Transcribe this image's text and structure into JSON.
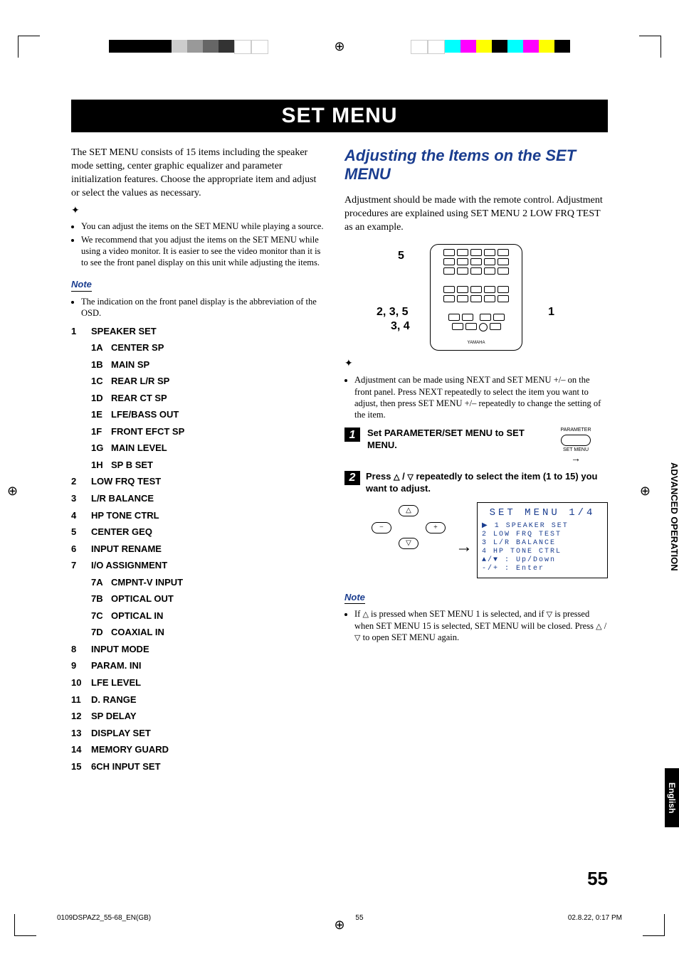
{
  "header": {
    "title": "SET MENU"
  },
  "left_column": {
    "intro": "The SET MENU consists of 15 items including the speaker mode setting, center graphic equalizer and parameter initialization features. Choose the appropriate item and adjust or select the values as necessary.",
    "hint_bullets": [
      "You can adjust the items on the SET MENU while playing a source.",
      "We recommend that you adjust the items on the SET MENU while using a video monitor. It is easier to see the video monitor than it is to see the front panel display on this unit while adjusting the items."
    ],
    "note_label": "Note",
    "note_bullets": [
      "The indication on the front panel display is the abbreviation of the OSD."
    ],
    "menu": [
      {
        "n": "1",
        "label": "SPEAKER SET",
        "subs": [
          {
            "n": "1A",
            "label": "CENTER SP"
          },
          {
            "n": "1B",
            "label": "MAIN SP"
          },
          {
            "n": "1C",
            "label": "REAR L/R SP"
          },
          {
            "n": "1D",
            "label": "REAR CT SP"
          },
          {
            "n": "1E",
            "label": "LFE/BASS OUT"
          },
          {
            "n": "1F",
            "label": "FRONT EFCT SP"
          },
          {
            "n": "1G",
            "label": "MAIN LEVEL"
          },
          {
            "n": "1H",
            "label": "SP B SET"
          }
        ]
      },
      {
        "n": "2",
        "label": "LOW FRQ TEST"
      },
      {
        "n": "3",
        "label": "L/R BALANCE"
      },
      {
        "n": "4",
        "label": "HP TONE CTRL"
      },
      {
        "n": "5",
        "label": "CENTER GEQ"
      },
      {
        "n": "6",
        "label": "INPUT RENAME"
      },
      {
        "n": "7",
        "label": "I/O ASSIGNMENT",
        "subs": [
          {
            "n": "7A",
            "label": "CMPNT-V INPUT"
          },
          {
            "n": "7B",
            "label": "OPTICAL OUT"
          },
          {
            "n": "7C",
            "label": "OPTICAL IN"
          },
          {
            "n": "7D",
            "label": "COAXIAL IN"
          }
        ]
      },
      {
        "n": "8",
        "label": "INPUT MODE"
      },
      {
        "n": "9",
        "label": "PARAM. INI"
      },
      {
        "n": "10",
        "label": "LFE LEVEL"
      },
      {
        "n": "11",
        "label": "D. RANGE"
      },
      {
        "n": "12",
        "label": "SP DELAY"
      },
      {
        "n": "13",
        "label": "DISPLAY SET"
      },
      {
        "n": "14",
        "label": "MEMORY GUARD"
      },
      {
        "n": "15",
        "label": "6CH INPUT SET"
      }
    ]
  },
  "right_column": {
    "section_title": "Adjusting the Items on the SET MENU",
    "intro": "Adjustment should be made with the remote control. Adjustment procedures are explained using SET MENU 2 LOW FRQ TEST as an example.",
    "callouts": {
      "c5": "5",
      "c235": "2, 3, 5",
      "c34": "3, 4",
      "c1": "1"
    },
    "remote_brand": "YAMAHA",
    "hint_bullets": [
      "Adjustment can be made using NEXT and SET MENU +/– on the front panel. Press NEXT repeatedly to select the item you want to adjust, then press SET MENU +/– repeatedly to change the setting of the item."
    ],
    "step1": {
      "num": "1",
      "text": "Set PARAMETER/SET MENU to SET MENU.",
      "switch_top": "PARAMETER",
      "switch_bottom": "SET MENU"
    },
    "step2": {
      "num": "2",
      "text_a": "Press ",
      "text_b": " / ",
      "text_c": " repeatedly to select the item (1 to 15) you want to adjust.",
      "lcd": {
        "title": "SET MENU 1/4",
        "lines": [
          "▶ 1 SPEAKER SET",
          "  2 LOW FRQ TEST",
          "  3 L/R BALANCE",
          "  4 HP TONE CTRL",
          "   ▲/▼ : Up/Down",
          "   -/+ : Enter"
        ]
      }
    },
    "note_label": "Note",
    "note2_a": "If ",
    "note2_b": " is pressed when SET MENU 1 is selected, and if ",
    "note2_c": " is pressed when SET MENU 15 is selected, SET MENU will be closed. Press ",
    "note2_d": " / ",
    "note2_e": " to open SET MENU again."
  },
  "side_tabs": {
    "advanced": "ADVANCED OPERATION",
    "english": "English"
  },
  "page_number": "55",
  "footer": {
    "left": "0109DSPAZ2_55-68_EN(GB)",
    "center": "55",
    "right": "02.8.22, 0:17 PM"
  }
}
